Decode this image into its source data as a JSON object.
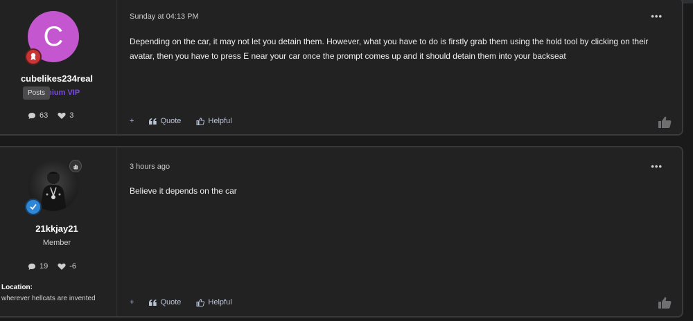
{
  "posts": [
    {
      "author": {
        "username": "cubelikes234real",
        "role": "Titanium VIP",
        "avatar_letter": "C",
        "avatar_color": "#c457cf",
        "tooltip": "Posts",
        "stats": {
          "posts": "63",
          "reactions": "3"
        }
      },
      "timestamp": "Sunday at 04:13 PM",
      "menu": "•••",
      "body": "Depending on the car, it may not let you detain them. However, what you have to do is firstly grab them using the hold tool by clicking on their avatar, then you have to press E near your car once the prompt comes up and it should detain them into your backseat",
      "actions": {
        "add": "+",
        "quote": "Quote",
        "helpful": "Helpful"
      }
    },
    {
      "author": {
        "username": "21kkjay21",
        "role": "Member",
        "stats": {
          "posts": "19",
          "reactions": "-6"
        },
        "location_label": "Location:",
        "location_value": "wherever hellcats are invented"
      },
      "timestamp": "3 hours ago",
      "menu": "•••",
      "body": "Believe it depends on the car",
      "actions": {
        "add": "+",
        "quote": "Quote",
        "helpful": "Helpful"
      }
    }
  ],
  "colors": {
    "vip": "#7a4be6",
    "action": "#b9c4d6",
    "background": "#1a1a1b"
  },
  "icons": {
    "posts": "chat-bubble-icon",
    "reactions": "heart-icon",
    "quote": "quote-icon",
    "helpful": "thumbs-up-icon",
    "like": "thumbs-up-icon"
  }
}
